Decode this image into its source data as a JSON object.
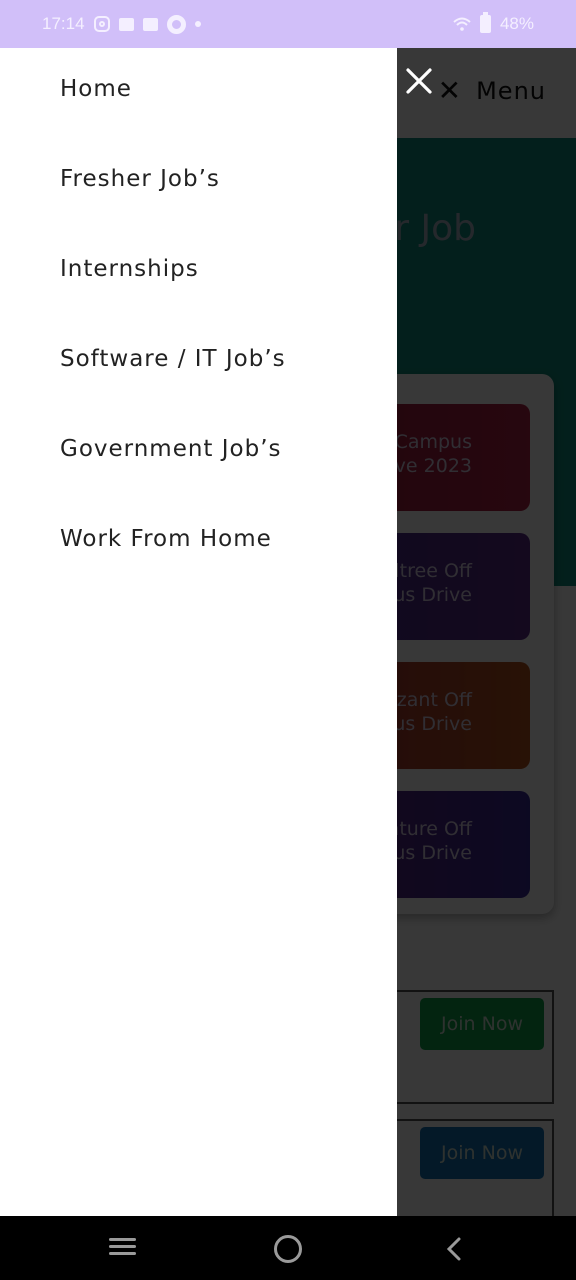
{
  "status_bar": {
    "time": "17:14",
    "notification_icons": [
      "instagram-icon",
      "message-icon",
      "message-icon",
      "circle-app-icon",
      "dot-icon"
    ],
    "battery": "48%",
    "wifi": "wifi-icon"
  },
  "drawer": {
    "close_icon": "close-icon",
    "items": [
      {
        "label": "Home"
      },
      {
        "label": "Fresher Job’s"
      },
      {
        "label": "Internships"
      },
      {
        "label": "Software / IT Job’s"
      },
      {
        "label": "Government Job’s"
      },
      {
        "label": "Work From Home"
      }
    ]
  },
  "background_page": {
    "menu_toggle": {
      "icon": "close-icon",
      "label": "Menu"
    },
    "hero_title_partial": "r Job",
    "job_cards": [
      {
        "line1": "Off Campus",
        "line2": "ve 2023",
        "color_start": "#8c1c34",
        "color_end": "#b02045"
      },
      {
        "line1": "ndtree Off",
        "line2": "pus Drive",
        "color_start": "#3b2c8e",
        "color_end": "#5b2a8a"
      },
      {
        "line1": "izant Off",
        "line2": "pus Drive",
        "color_start": "#9b2040",
        "color_end": "#b5521b"
      },
      {
        "line1": "nture Off",
        "line2": "pus Drive",
        "color_start": "#6c1b6b",
        "color_end": "#3a2a9a"
      }
    ],
    "join_buttons": [
      {
        "label": "Join Now",
        "color": "#0fa24a"
      },
      {
        "label": "Join Now",
        "color": "#1572b8"
      }
    ]
  },
  "nav_bar": {
    "recent": "recent-apps-icon",
    "home": "home-icon",
    "back": "back-icon"
  },
  "colors": {
    "status_bar": "#d1bff9",
    "hero": "#0f8f7e",
    "drawer": "#ffffff"
  }
}
